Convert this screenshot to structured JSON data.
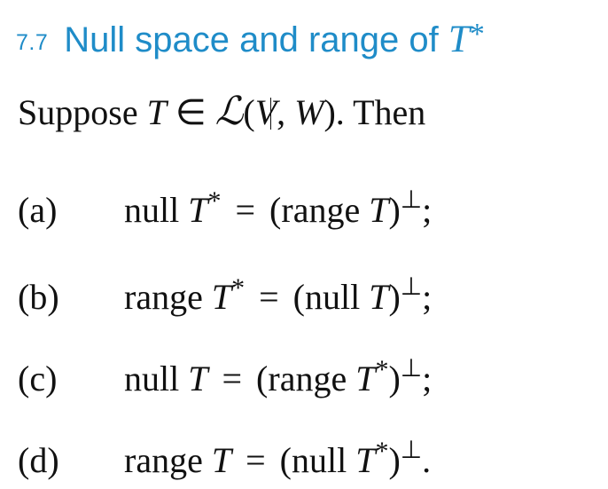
{
  "section": {
    "number": "7.7",
    "title_prefix": "Null space and range of ",
    "title_operator": "T",
    "title_star": "*"
  },
  "intro": {
    "lead": "Suppose ",
    "operator": "T",
    "membership": " ∈ ",
    "space_symbol": "ℒ",
    "open_paren": "(",
    "domain": "V",
    "comma": ", ",
    "codomain": "W",
    "close_tail": "). Then"
  },
  "items": [
    {
      "label": "(a)",
      "left_word": "null ",
      "left_op": "T",
      "left_star": "*",
      "equals": "=",
      "right_open": "(range ",
      "right_op": "T",
      "right_star": "",
      "right_close": ")",
      "perp": "⊥",
      "end": ";"
    },
    {
      "label": "(b)",
      "left_word": "range ",
      "left_op": "T",
      "left_star": "*",
      "equals": "=",
      "right_open": "(null ",
      "right_op": "T",
      "right_star": "",
      "right_close": ")",
      "perp": "⊥",
      "end": ";"
    },
    {
      "label": "(c)",
      "left_word": "null ",
      "left_op": "T",
      "left_star": "",
      "equals": "=",
      "right_open": "(range ",
      "right_op": "T",
      "right_star": "*",
      "right_close": ")",
      "perp": "⊥",
      "end": ";"
    },
    {
      "label": "(d)",
      "left_word": "range ",
      "left_op": "T",
      "left_star": "",
      "equals": "=",
      "right_open": "(null ",
      "right_op": "T",
      "right_star": "*",
      "right_close": ")",
      "perp": "⊥",
      "end": "."
    }
  ],
  "colors": {
    "heading": "#1f8cc8",
    "text": "#111111",
    "background": "#ffffff"
  }
}
